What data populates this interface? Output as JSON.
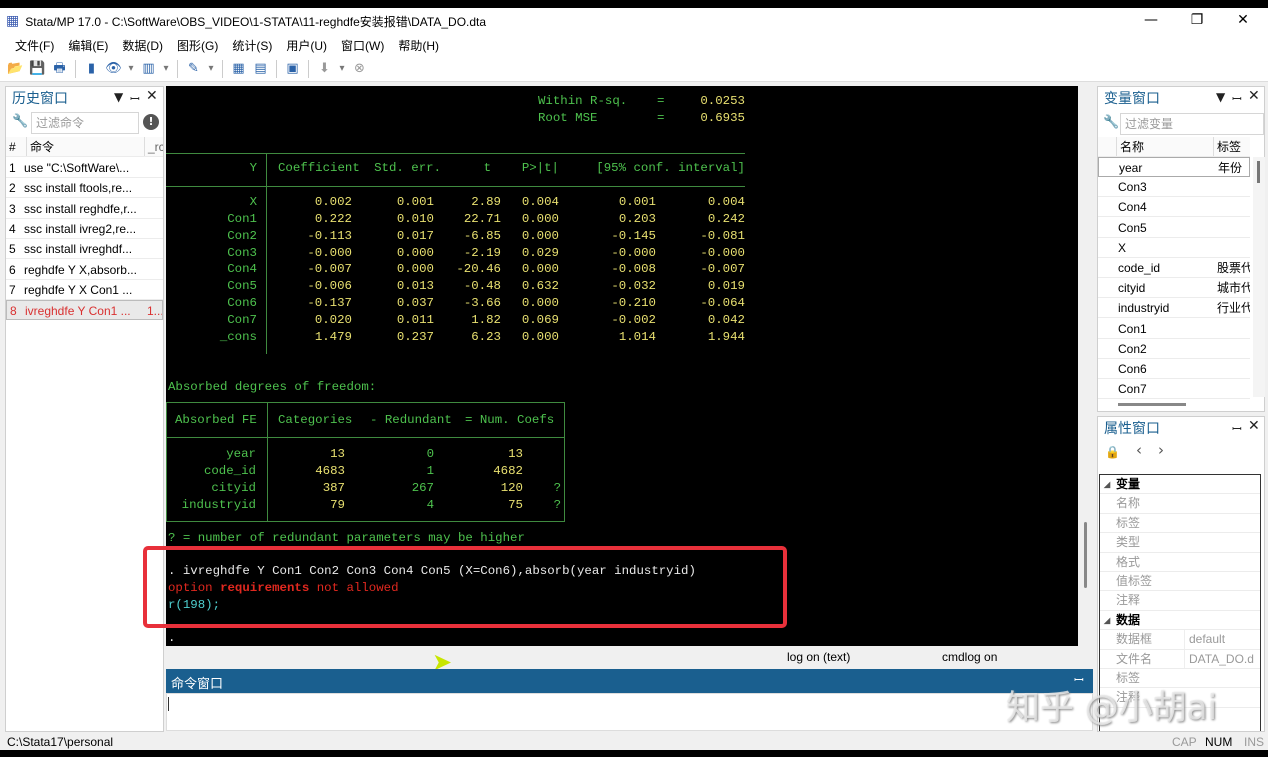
{
  "window": {
    "title": "Stata/MP 17.0 - C:\\SoftWare\\OBS_VIDEO\\1-STATA\\11-reghdfe安装报错\\DATA_DO.dta",
    "minimize": "—",
    "maximize": "❐",
    "close": "✕"
  },
  "menu": [
    "文件(F)",
    "编辑(E)",
    "数据(D)",
    "图形(G)",
    "统计(S)",
    "用户(U)",
    "窗口(W)",
    "帮助(H)"
  ],
  "toolbar": [
    {
      "icon": "open-icon",
      "g": "📂"
    },
    {
      "icon": "save-icon",
      "g": "💾"
    },
    {
      "icon": "print-icon",
      "g": "🖶"
    },
    {
      "sep": true
    },
    {
      "icon": "log-icon",
      "g": "▮"
    },
    {
      "icon": "viewer-icon",
      "g": "👁"
    },
    {
      "icon": "dropdown-icon",
      "g": "▾"
    },
    {
      "icon": "graph-icon",
      "g": "▥"
    },
    {
      "icon": "dropdown-icon",
      "g": "▾"
    },
    {
      "sep": true
    },
    {
      "icon": "do-file-editor-icon",
      "g": "✎"
    },
    {
      "icon": "dropdown-icon",
      "g": "▾"
    },
    {
      "sep": true
    },
    {
      "icon": "data-editor-icon",
      "g": "▦"
    },
    {
      "icon": "data-browser-icon",
      "g": "▤"
    },
    {
      "sep": true
    },
    {
      "icon": "variables-manager-icon",
      "g": "▣"
    },
    {
      "sep": true
    },
    {
      "icon": "more-icon",
      "g": "⬇"
    },
    {
      "icon": "dropdown-icon",
      "g": "▾"
    },
    {
      "icon": "break-icon",
      "g": "⊗"
    }
  ],
  "history": {
    "title": "历史窗口",
    "filter_placeholder": "过滤命令",
    "col_num": "#",
    "col_cmd": "命令",
    "col_rc": "_rc",
    "items": [
      {
        "n": "1",
        "cmd": "use \"C:\\SoftWare\\...",
        "rc": ""
      },
      {
        "n": "2",
        "cmd": "ssc install ftools,re...",
        "rc": ""
      },
      {
        "n": "3",
        "cmd": "ssc install reghdfe,r...",
        "rc": ""
      },
      {
        "n": "4",
        "cmd": "ssc install ivreg2,re...",
        "rc": ""
      },
      {
        "n": "5",
        "cmd": "ssc install ivreghdf...",
        "rc": ""
      },
      {
        "n": "6",
        "cmd": "reghdfe Y X,absorb...",
        "rc": ""
      },
      {
        "n": "7",
        "cmd": "reghdfe Y X Con1 ...",
        "rc": ""
      },
      {
        "n": "8",
        "cmd": "ivreghdfe Y Con1 ...",
        "rc": "1..."
      }
    ]
  },
  "results": {
    "stats": [
      {
        "label": "Within R-sq.",
        "eq": "=",
        "value": "0.0253"
      },
      {
        "label": "Root MSE",
        "eq": "=",
        "value": "0.6935"
      }
    ],
    "reg_header": [
      "Y",
      "Coefficient",
      "Std. err.",
      "t",
      "P>|t|",
      "[95% conf. interval]"
    ],
    "reg_rows": [
      [
        "X",
        "0.002",
        "0.001",
        "2.89",
        "0.004",
        "0.001",
        "0.004"
      ],
      [
        "Con1",
        "0.222",
        "0.010",
        "22.71",
        "0.000",
        "0.203",
        "0.242"
      ],
      [
        "Con2",
        "-0.113",
        "0.017",
        "-6.85",
        "0.000",
        "-0.145",
        "-0.081"
      ],
      [
        "Con3",
        "-0.000",
        "0.000",
        "-2.19",
        "0.029",
        "-0.000",
        "-0.000"
      ],
      [
        "Con4",
        "-0.007",
        "0.000",
        "-20.46",
        "0.000",
        "-0.008",
        "-0.007"
      ],
      [
        "Con5",
        "-0.006",
        "0.013",
        "-0.48",
        "0.632",
        "-0.032",
        "0.019"
      ],
      [
        "Con6",
        "-0.137",
        "0.037",
        "-3.66",
        "0.000",
        "-0.210",
        "-0.064"
      ],
      [
        "Con7",
        "0.020",
        "0.011",
        "1.82",
        "0.069",
        "-0.002",
        "0.042"
      ],
      [
        "_cons",
        "1.479",
        "0.237",
        "6.23",
        "0.000",
        "1.014",
        "1.944"
      ]
    ],
    "absorbed_title": "Absorbed degrees of freedom:",
    "abs_header": [
      "Absorbed FE",
      "Categories",
      "- Redundant",
      "= Num. Coefs"
    ],
    "abs_rows": [
      [
        "year",
        "13",
        "0",
        "13",
        ""
      ],
      [
        "code_id",
        "4683",
        "1",
        "4682",
        ""
      ],
      [
        "cityid",
        "387",
        "267",
        "120",
        "?"
      ],
      [
        "industryid",
        "79",
        "4",
        "75",
        "?"
      ]
    ],
    "footnote": "? = number of redundant parameters may be higher",
    "command": ". ivreghdfe Y Con1 Con2 Con3 Con4 Con5 (X=Con6),absorb(year industryid)",
    "error_pre": "option ",
    "error_bold": "requirements",
    "error_post": " not allowed",
    "rc": "r(198);",
    "prompt": "."
  },
  "status_row": {
    "log": "log on (text)",
    "cmdlog": "cmdlog on"
  },
  "command_window": {
    "title": "命令窗口",
    "pin": "ꟷ"
  },
  "variables": {
    "title": "变量窗口",
    "filter_placeholder": "过滤变量",
    "col_name": "名称",
    "col_label": "标签",
    "items": [
      {
        "name": "year",
        "label": "年份"
      },
      {
        "name": "Con3",
        "label": ""
      },
      {
        "name": "Con4",
        "label": ""
      },
      {
        "name": "Con5",
        "label": ""
      },
      {
        "name": "X",
        "label": ""
      },
      {
        "name": "code_id",
        "label": "股票代"
      },
      {
        "name": "cityid",
        "label": "城市代"
      },
      {
        "name": "industryid",
        "label": "行业代"
      },
      {
        "name": "Con1",
        "label": ""
      },
      {
        "name": "Con2",
        "label": ""
      },
      {
        "name": "Con6",
        "label": ""
      },
      {
        "name": "Con7",
        "label": ""
      }
    ]
  },
  "properties": {
    "title": "属性窗口",
    "sections": [
      {
        "title": "变量",
        "rows": [
          {
            "k": "名称",
            "v": ""
          },
          {
            "k": "标签",
            "v": ""
          },
          {
            "k": "类型",
            "v": ""
          },
          {
            "k": "格式",
            "v": ""
          },
          {
            "k": "值标签",
            "v": ""
          },
          {
            "k": "注释",
            "v": ""
          }
        ]
      },
      {
        "title": "数据",
        "rows": [
          {
            "k": "数据框",
            "v": "default"
          },
          {
            "k": "文件名",
            "v": "DATA_DO.dta"
          },
          {
            "k": "标签",
            "v": ""
          },
          {
            "k": "注释",
            "v": ""
          }
        ]
      }
    ]
  },
  "statusbar": {
    "path": "C:\\Stata17\\personal",
    "cap": "CAP",
    "num": "NUM",
    "ins": "INS"
  },
  "watermark": "知乎 @小胡ai",
  "colors": {
    "accent": "#1a5f8f",
    "green": "#4ec24e",
    "yellow": "#e8e070",
    "error": "#e0281f",
    "highlight_box": "#e8303a"
  }
}
